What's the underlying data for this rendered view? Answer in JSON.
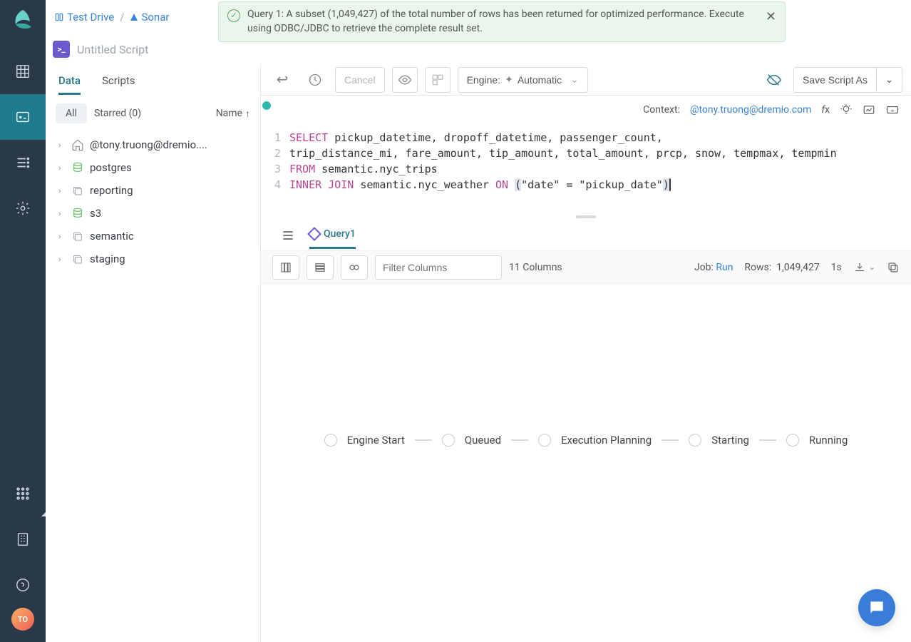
{
  "breadcrumbs": {
    "first": "Test Drive",
    "second": "Sonar"
  },
  "banner": {
    "text": "Query 1: A subset (1,049,427) of the total number of rows has been returned for optimized performance. Execute using ODBC/JDBC to retrieve the complete result set."
  },
  "script": {
    "title": "Untitled Script",
    "icon": ">_"
  },
  "sidebar": {
    "tabs": {
      "data": "Data",
      "scripts": "Scripts"
    },
    "filters": {
      "all": "All",
      "starred": "Starred (0)",
      "name": "Name"
    },
    "nodes": [
      {
        "label": "@tony.truong@dremio....",
        "icon": "home"
      },
      {
        "label": "postgres",
        "icon": "db"
      },
      {
        "label": "reporting",
        "icon": "folder"
      },
      {
        "label": "s3",
        "icon": "db"
      },
      {
        "label": "semantic",
        "icon": "folder"
      },
      {
        "label": "staging",
        "icon": "folder"
      }
    ]
  },
  "toolbar": {
    "cancel": "Cancel",
    "engine_label": "Engine:",
    "engine_value": "Automatic",
    "save": "Save Script As"
  },
  "context": {
    "label": "Context:",
    "value": "@tony.truong@dremio.com"
  },
  "editor": {
    "lines": [
      {
        "n": "1",
        "pre": "SELECT",
        "rest": " pickup_datetime, dropoff_datetime, passenger_count,"
      },
      {
        "n": "2",
        "rest": "trip_distance_mi, fare_amount, tip_amount, total_amount, prcp, snow, tempmax, tempmin"
      },
      {
        "n": "3",
        "pre": "FROM",
        "rest": " semantic.nyc_trips"
      },
      {
        "n": "4",
        "pre": "INNER JOIN",
        "mid": " semantic.nyc_weather ",
        "on": "ON",
        "paren_l": "(",
        "body": "\"date\" = \"pickup_date\"",
        "paren_r": ")"
      }
    ]
  },
  "results": {
    "tab": "Query1",
    "filter_placeholder": "Filter Columns",
    "columns": "11 Columns",
    "job_label": "Job:",
    "job_value": "Run",
    "rows_label": "Rows:",
    "rows_value": "1,049,427",
    "time": "1s"
  },
  "pipeline": [
    "Engine Start",
    "Queued",
    "Execution Planning",
    "Starting",
    "Running"
  ],
  "avatar": "TO"
}
